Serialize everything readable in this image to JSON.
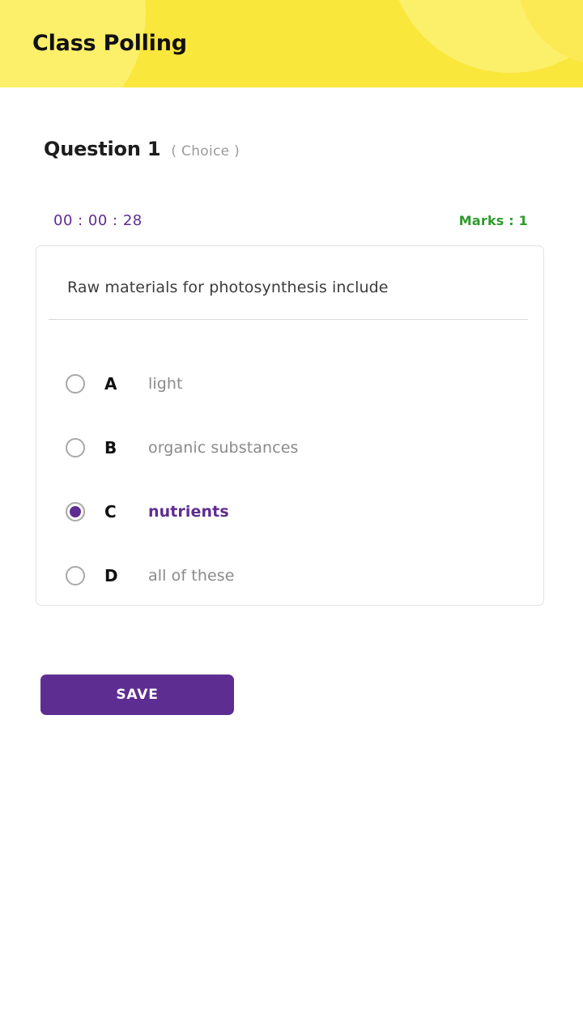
{
  "header": {
    "title": "Class Polling",
    "background_color": "#FAE73C"
  },
  "question": {
    "label": "Question 1",
    "type": "( Choice )",
    "timer": "00 : 00 : 28",
    "marks": "Marks : 1",
    "text": "Raw materials for photosynthesis include",
    "options": [
      {
        "letter": "A",
        "text": "light",
        "selected": false
      },
      {
        "letter": "B",
        "text": "organic substances",
        "selected": false
      },
      {
        "letter": "C",
        "text": "nutrients",
        "selected": true
      },
      {
        "letter": "D",
        "text": "all of these",
        "selected": false
      }
    ]
  },
  "actions": {
    "save_label": "SAVE"
  },
  "colors": {
    "accent_purple": "#5E2D91",
    "marks_green": "#2E9B2E",
    "header_yellow": "#FAE73C"
  }
}
